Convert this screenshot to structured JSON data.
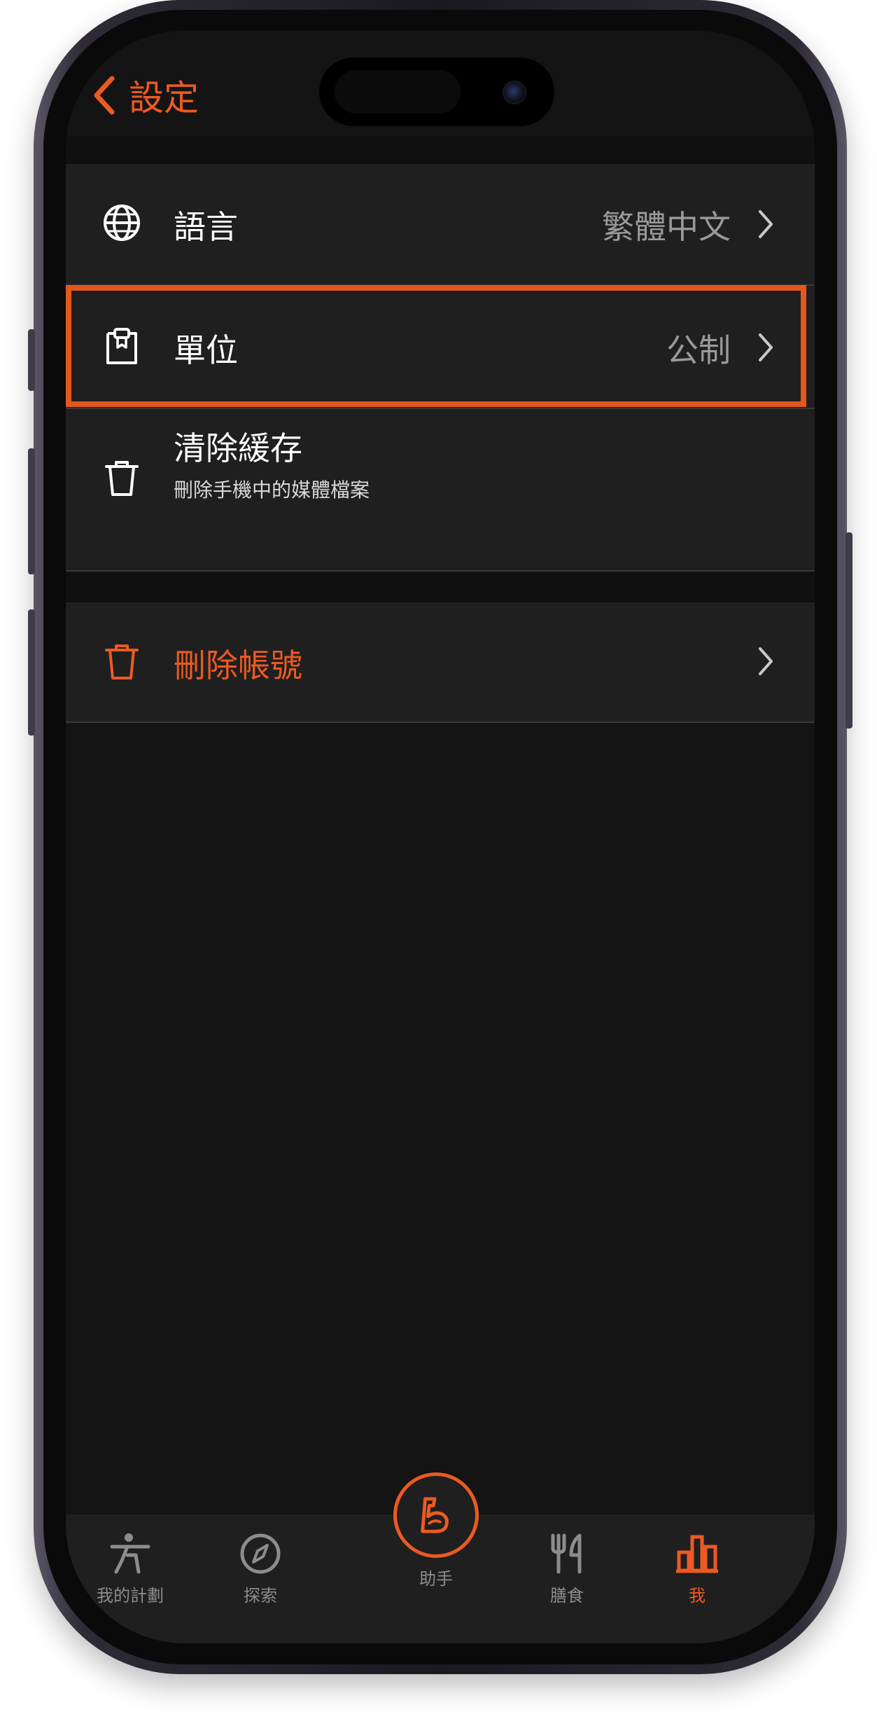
{
  "nav": {
    "back_label": "設定",
    "accent_color": "#ec5a22"
  },
  "settings": {
    "language": {
      "label": "語言",
      "value": "繁體中文",
      "icon": "globe-icon"
    },
    "units": {
      "label": "單位",
      "value": "公制",
      "icon": "clipboard-icon",
      "highlighted": true
    },
    "clear_cache": {
      "label": "清除緩存",
      "sublabel": "刪除手機中的媒體檔案",
      "icon": "trash-icon"
    },
    "delete_account": {
      "label": "刪除帳號",
      "icon": "trash-icon",
      "color": "#ec5a22"
    }
  },
  "tabbar": {
    "tabs": [
      {
        "label": "我的計劃",
        "icon": "exercise-person-icon",
        "active": false
      },
      {
        "label": "探索",
        "icon": "compass-icon",
        "active": false
      },
      {
        "label": "助手",
        "icon": "muscle-arm-icon",
        "active": false
      },
      {
        "label": "膳食",
        "icon": "fork-knife-icon",
        "active": false
      },
      {
        "label": "我",
        "icon": "bar-chart-icon",
        "active": true
      }
    ]
  }
}
